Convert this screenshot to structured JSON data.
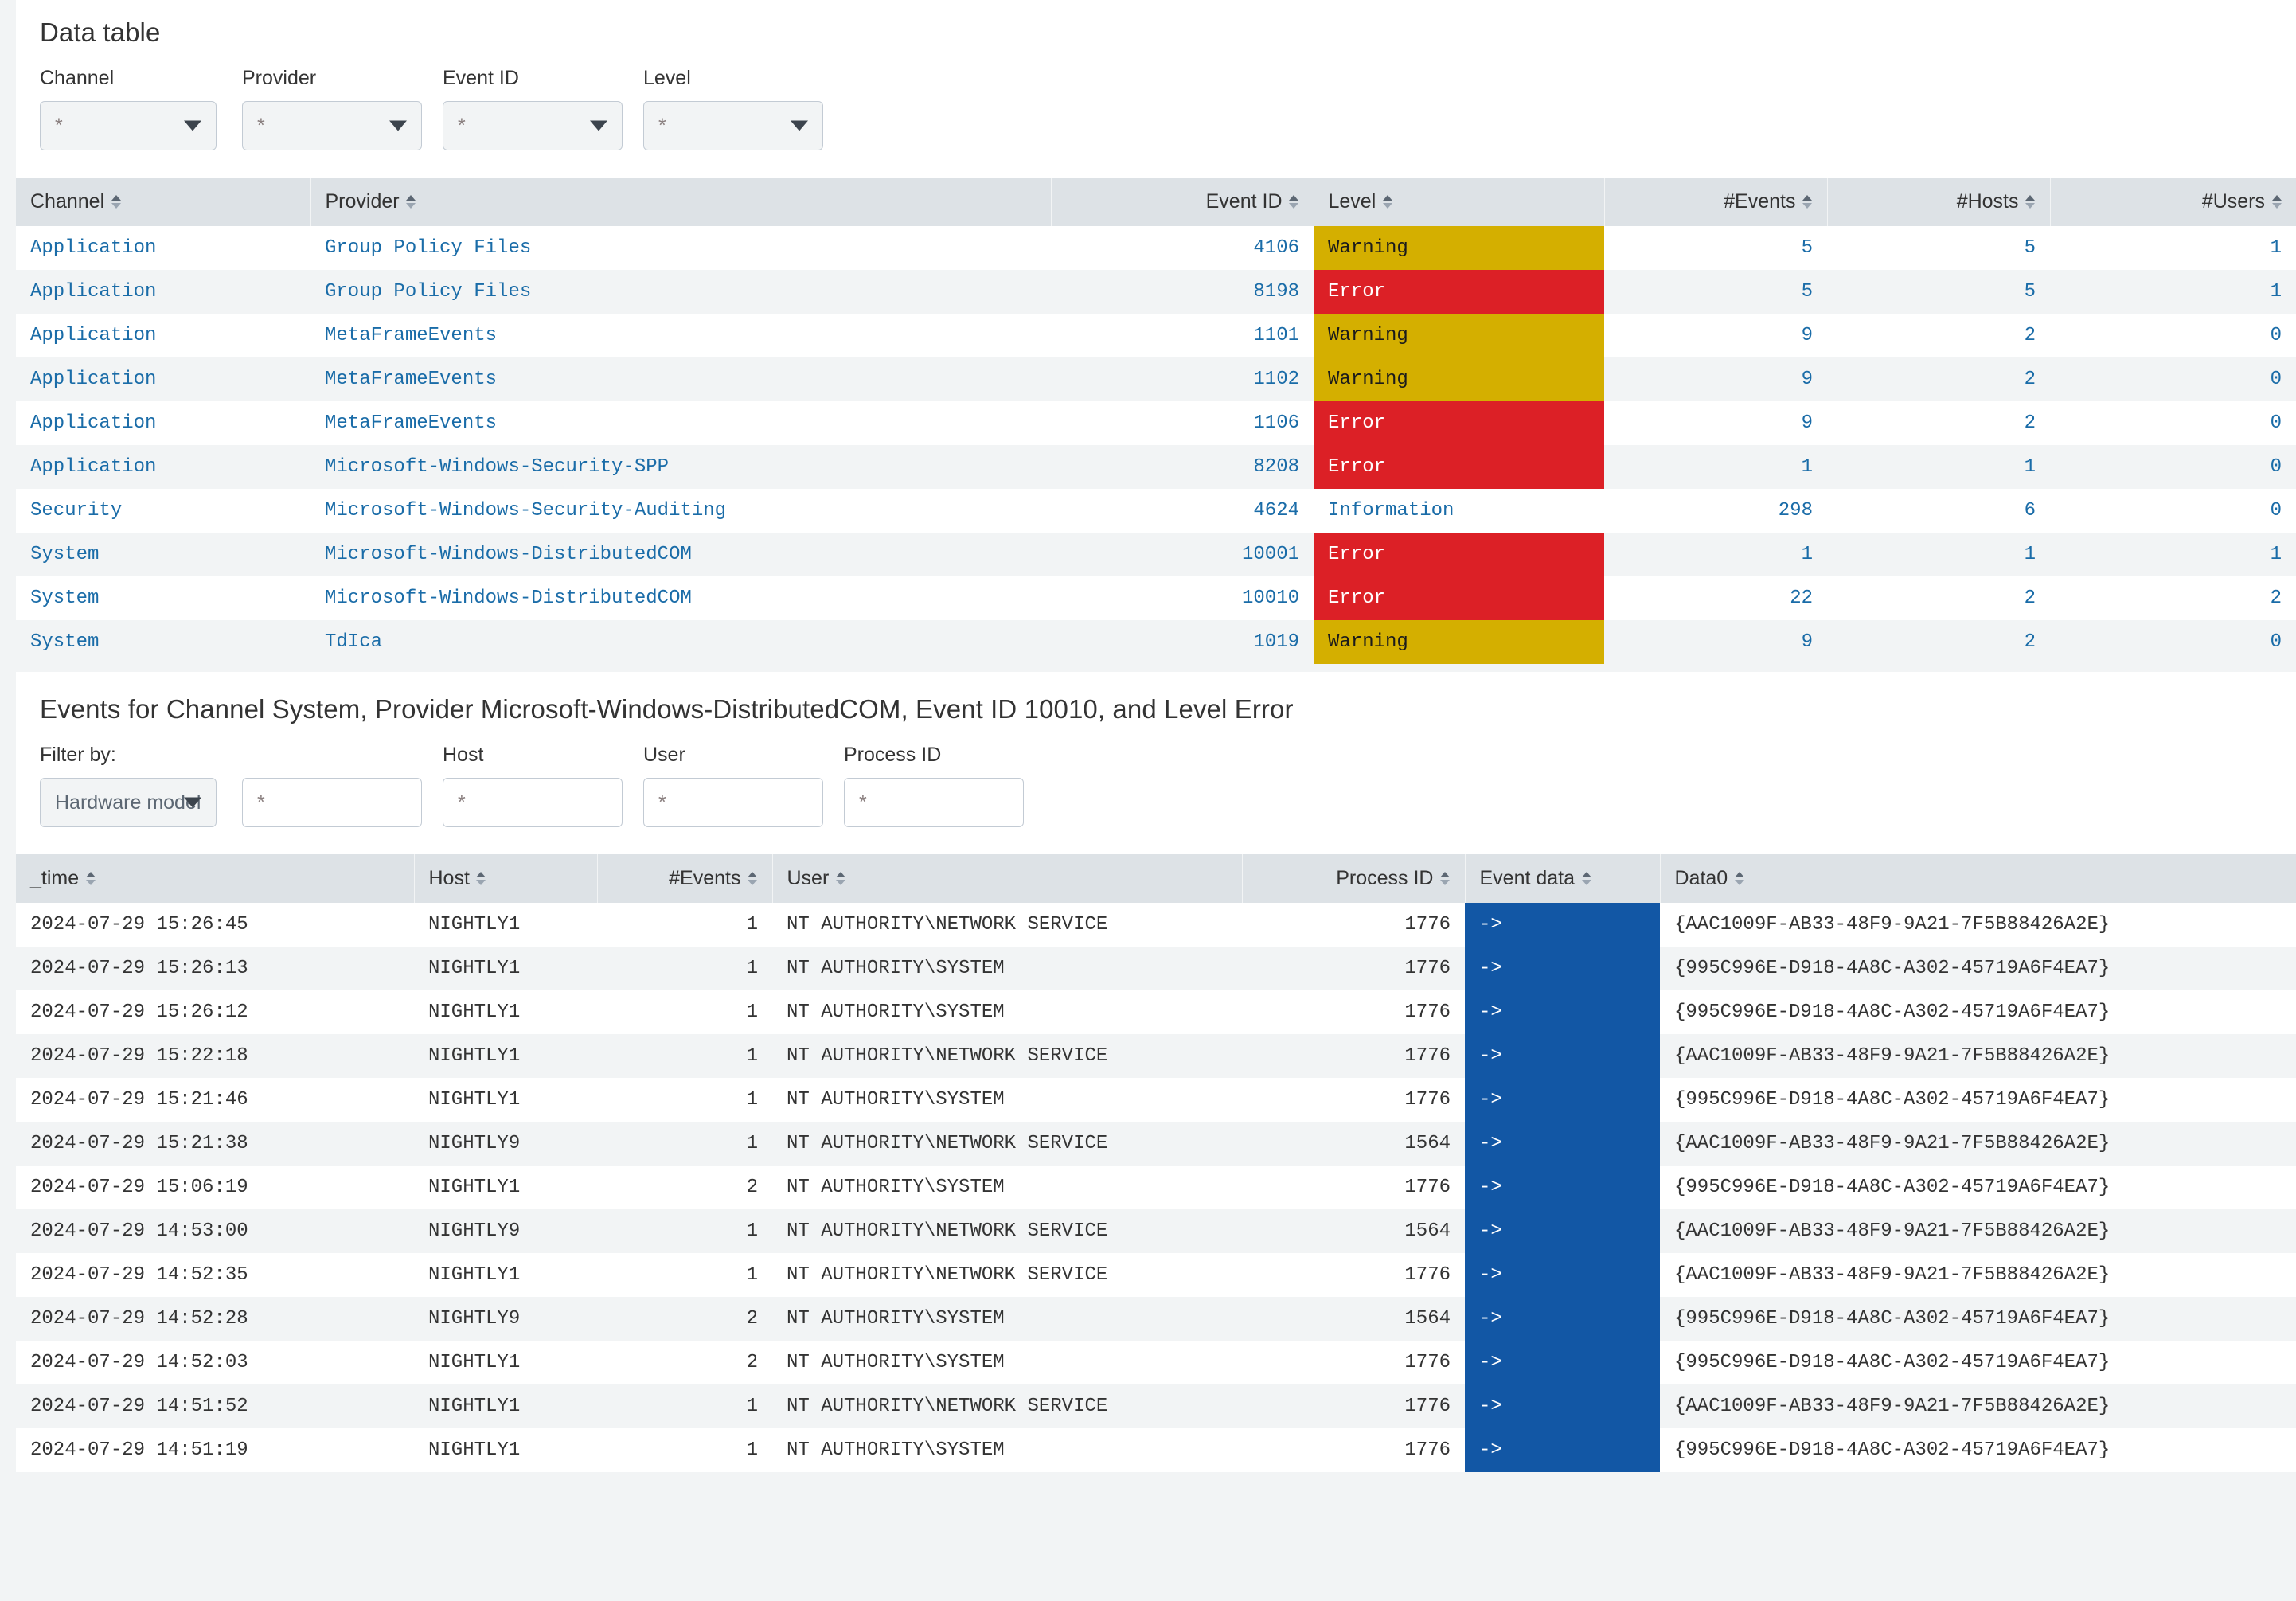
{
  "top_panel": {
    "title": "Data table",
    "filters": [
      {
        "label": "Channel",
        "value": "*",
        "type": "select"
      },
      {
        "label": "Provider",
        "value": "*",
        "type": "select"
      },
      {
        "label": "Event ID",
        "value": "*",
        "type": "select"
      },
      {
        "label": "Level",
        "value": "*",
        "type": "select"
      }
    ],
    "table": {
      "columns": [
        "Channel",
        "Provider",
        "Event ID",
        "Level",
        "#Events",
        "#Hosts",
        "#Users"
      ],
      "rows": [
        {
          "channel": "Application",
          "provider": "Group Policy Files",
          "event_id": "4106",
          "level": "Warning",
          "level_kind": "warning",
          "events": "5",
          "hosts": "5",
          "users": "1"
        },
        {
          "channel": "Application",
          "provider": "Group Policy Files",
          "event_id": "8198",
          "level": "Error",
          "level_kind": "error",
          "events": "5",
          "hosts": "5",
          "users": "1"
        },
        {
          "channel": "Application",
          "provider": "MetaFrameEvents",
          "event_id": "1101",
          "level": "Warning",
          "level_kind": "warning",
          "events": "9",
          "hosts": "2",
          "users": "0"
        },
        {
          "channel": "Application",
          "provider": "MetaFrameEvents",
          "event_id": "1102",
          "level": "Warning",
          "level_kind": "warning",
          "events": "9",
          "hosts": "2",
          "users": "0"
        },
        {
          "channel": "Application",
          "provider": "MetaFrameEvents",
          "event_id": "1106",
          "level": "Error",
          "level_kind": "error",
          "events": "9",
          "hosts": "2",
          "users": "0"
        },
        {
          "channel": "Application",
          "provider": "Microsoft-Windows-Security-SPP",
          "event_id": "8208",
          "level": "Error",
          "level_kind": "error",
          "events": "1",
          "hosts": "1",
          "users": "0"
        },
        {
          "channel": "Security",
          "provider": "Microsoft-Windows-Security-Auditing",
          "event_id": "4624",
          "level": "Information",
          "level_kind": "info",
          "events": "298",
          "hosts": "6",
          "users": "0"
        },
        {
          "channel": "System",
          "provider": "Microsoft-Windows-DistributedCOM",
          "event_id": "10001",
          "level": "Error",
          "level_kind": "error",
          "events": "1",
          "hosts": "1",
          "users": "1"
        },
        {
          "channel": "System",
          "provider": "Microsoft-Windows-DistributedCOM",
          "event_id": "10010",
          "level": "Error",
          "level_kind": "error",
          "events": "22",
          "hosts": "2",
          "users": "2"
        },
        {
          "channel": "System",
          "provider": "TdIca",
          "event_id": "1019",
          "level": "Warning",
          "level_kind": "warning",
          "events": "9",
          "hosts": "2",
          "users": "0"
        }
      ]
    }
  },
  "bottom_panel": {
    "title": "Events for Channel System, Provider Microsoft-Windows-DistributedCOM, Event ID 10010, and Level Error",
    "filters": [
      {
        "label": "Filter by:",
        "value": "Hardware model",
        "type": "select"
      },
      {
        "label": "",
        "value": "*",
        "type": "input"
      },
      {
        "label": "Host",
        "value": "*",
        "type": "input"
      },
      {
        "label": "User",
        "value": "*",
        "type": "input"
      },
      {
        "label": "Process ID",
        "value": "*",
        "type": "input"
      }
    ],
    "table": {
      "columns": [
        "_time",
        "Host",
        "#Events",
        "User",
        "Process ID",
        "Event data",
        "Data0"
      ],
      "rows": [
        {
          "time": "2024-07-29 15:26:45",
          "host": "NIGHTLY1",
          "events": "1",
          "user": "NT AUTHORITY\\NETWORK SERVICE",
          "pid": "1776",
          "event_data": "->",
          "data0": "{AAC1009F-AB33-48F9-9A21-7F5B88426A2E}"
        },
        {
          "time": "2024-07-29 15:26:13",
          "host": "NIGHTLY1",
          "events": "1",
          "user": "NT AUTHORITY\\SYSTEM",
          "pid": "1776",
          "event_data": "->",
          "data0": "{995C996E-D918-4A8C-A302-45719A6F4EA7}"
        },
        {
          "time": "2024-07-29 15:26:12",
          "host": "NIGHTLY1",
          "events": "1",
          "user": "NT AUTHORITY\\SYSTEM",
          "pid": "1776",
          "event_data": "->",
          "data0": "{995C996E-D918-4A8C-A302-45719A6F4EA7}"
        },
        {
          "time": "2024-07-29 15:22:18",
          "host": "NIGHTLY1",
          "events": "1",
          "user": "NT AUTHORITY\\NETWORK SERVICE",
          "pid": "1776",
          "event_data": "->",
          "data0": "{AAC1009F-AB33-48F9-9A21-7F5B88426A2E}"
        },
        {
          "time": "2024-07-29 15:21:46",
          "host": "NIGHTLY1",
          "events": "1",
          "user": "NT AUTHORITY\\SYSTEM",
          "pid": "1776",
          "event_data": "->",
          "data0": "{995C996E-D918-4A8C-A302-45719A6F4EA7}"
        },
        {
          "time": "2024-07-29 15:21:38",
          "host": "NIGHTLY9",
          "events": "1",
          "user": "NT AUTHORITY\\NETWORK SERVICE",
          "pid": "1564",
          "event_data": "->",
          "data0": "{AAC1009F-AB33-48F9-9A21-7F5B88426A2E}"
        },
        {
          "time": "2024-07-29 15:06:19",
          "host": "NIGHTLY1",
          "events": "2",
          "user": "NT AUTHORITY\\SYSTEM",
          "pid": "1776",
          "event_data": "->",
          "data0": "{995C996E-D918-4A8C-A302-45719A6F4EA7}"
        },
        {
          "time": "2024-07-29 14:53:00",
          "host": "NIGHTLY9",
          "events": "1",
          "user": "NT AUTHORITY\\NETWORK SERVICE",
          "pid": "1564",
          "event_data": "->",
          "data0": "{AAC1009F-AB33-48F9-9A21-7F5B88426A2E}"
        },
        {
          "time": "2024-07-29 14:52:35",
          "host": "NIGHTLY1",
          "events": "1",
          "user": "NT AUTHORITY\\NETWORK SERVICE",
          "pid": "1776",
          "event_data": "->",
          "data0": "{AAC1009F-AB33-48F9-9A21-7F5B88426A2E}"
        },
        {
          "time": "2024-07-29 14:52:28",
          "host": "NIGHTLY9",
          "events": "2",
          "user": "NT AUTHORITY\\SYSTEM",
          "pid": "1564",
          "event_data": "->",
          "data0": "{995C996E-D918-4A8C-A302-45719A6F4EA7}"
        },
        {
          "time": "2024-07-29 14:52:03",
          "host": "NIGHTLY1",
          "events": "2",
          "user": "NT AUTHORITY\\SYSTEM",
          "pid": "1776",
          "event_data": "->",
          "data0": "{995C996E-D918-4A8C-A302-45719A6F4EA7}"
        },
        {
          "time": "2024-07-29 14:51:52",
          "host": "NIGHTLY1",
          "events": "1",
          "user": "NT AUTHORITY\\NETWORK SERVICE",
          "pid": "1776",
          "event_data": "->",
          "data0": "{AAC1009F-AB33-48F9-9A21-7F5B88426A2E}"
        },
        {
          "time": "2024-07-29 14:51:19",
          "host": "NIGHTLY1",
          "events": "1",
          "user": "NT AUTHORITY\\SYSTEM",
          "pid": "1776",
          "event_data": "->",
          "data0": "{995C996E-D918-4A8C-A302-45719A6F4EA7}"
        }
      ]
    }
  },
  "colors": {
    "warning_bg": "#d4af00",
    "error_bg": "#dc2026",
    "eventdata_bg": "#1257a5",
    "link": "#1a6ca8",
    "header_bg": "#dde2e6",
    "page_bg": "#f2f4f5"
  }
}
